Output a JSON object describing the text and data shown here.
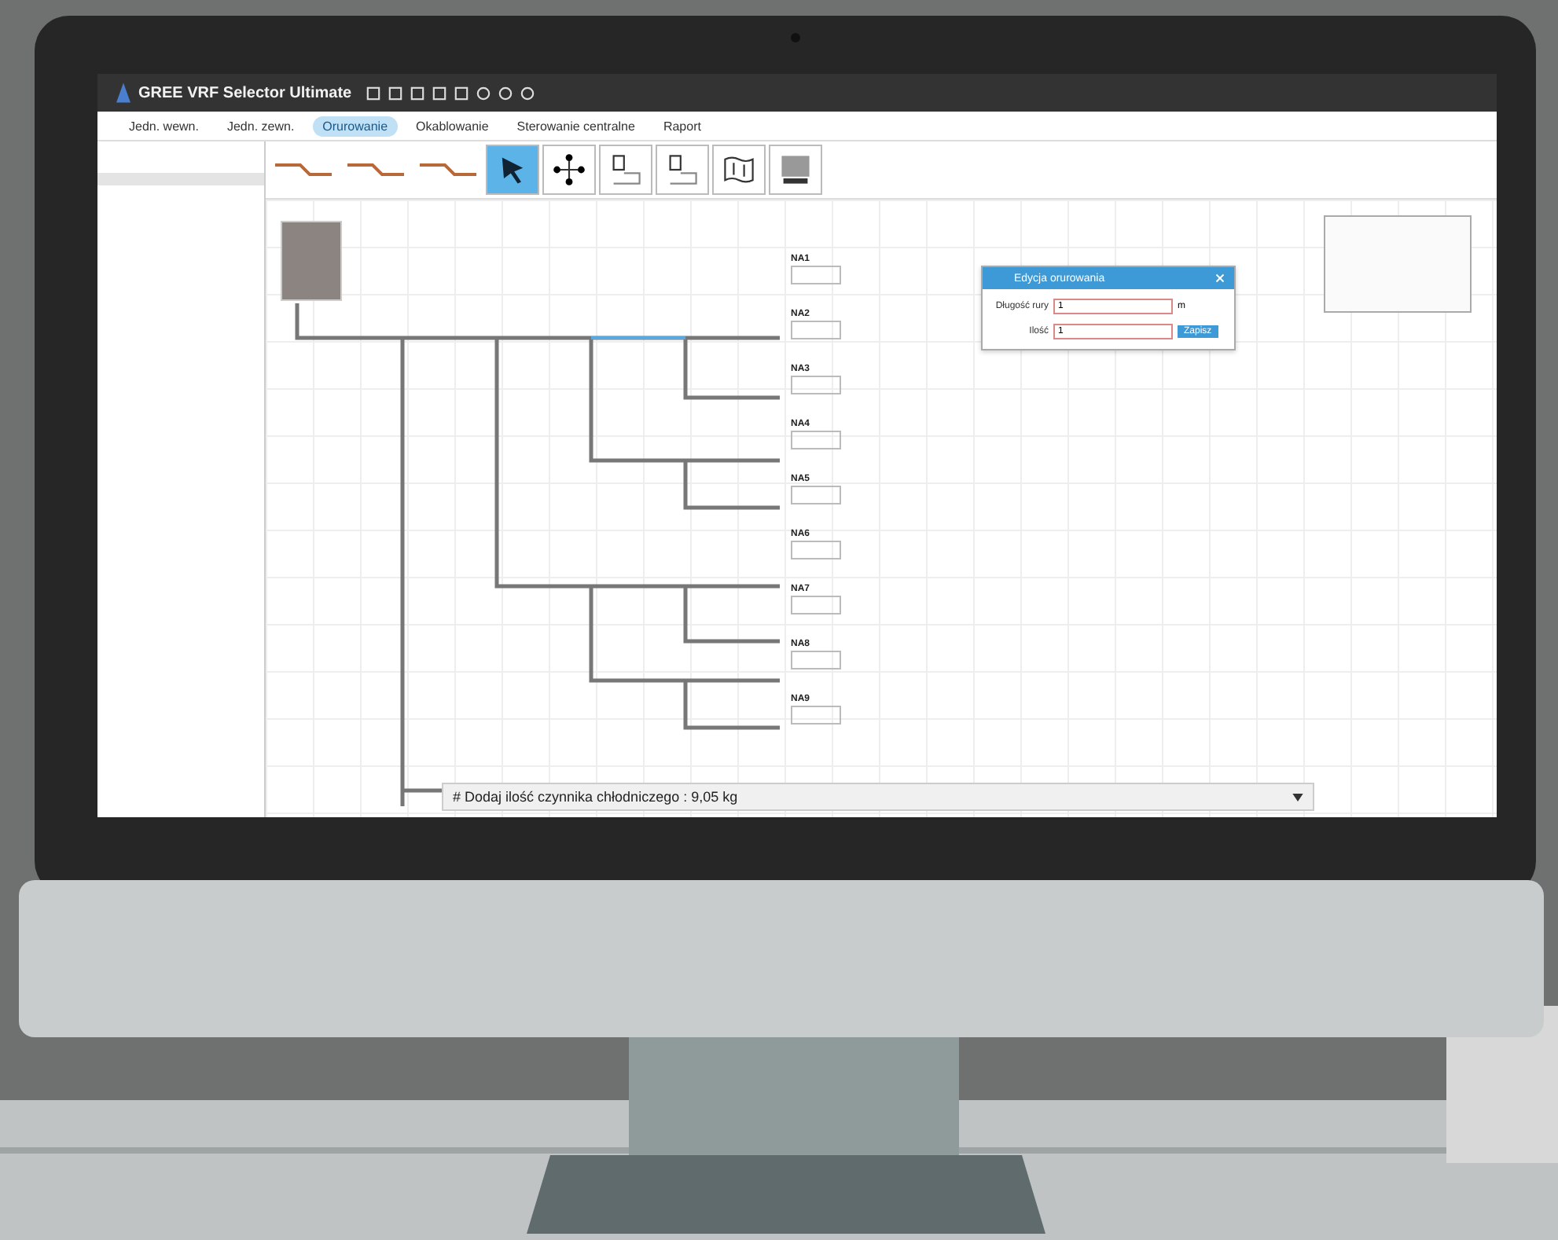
{
  "window": {
    "title": "GREE VRF Selector Ultimate"
  },
  "tabs": [
    {
      "label": "Jedn. wewn.",
      "selected": false
    },
    {
      "label": "Jedn. zewn.",
      "selected": false
    },
    {
      "label": "Orurowanie",
      "selected": true
    },
    {
      "label": "Okablowanie",
      "selected": false
    },
    {
      "label": "Sterowanie centralne",
      "selected": false
    },
    {
      "label": "Raport",
      "selected": false
    }
  ],
  "toolbar": [
    {
      "kind": "pipe",
      "selected": false
    },
    {
      "kind": "pipe",
      "selected": false
    },
    {
      "kind": "pipe",
      "selected": false
    },
    {
      "kind": "select",
      "selected": true
    },
    {
      "kind": "move",
      "selected": false
    },
    {
      "kind": "unit",
      "selected": false
    },
    {
      "kind": "unit",
      "selected": false
    },
    {
      "kind": "map",
      "selected": false
    },
    {
      "kind": "grid",
      "selected": false
    }
  ],
  "indoor_units": [
    {
      "label": "NA1"
    },
    {
      "label": "NA2"
    },
    {
      "label": "NA3"
    },
    {
      "label": "NA4"
    },
    {
      "label": "NA5"
    },
    {
      "label": "NA6"
    },
    {
      "label": "NA7"
    },
    {
      "label": "NA8"
    },
    {
      "label": "NA9"
    }
  ],
  "dialog": {
    "title": "Edycja orurowania",
    "length_label": "Długość rury",
    "length_value": "1",
    "unit": "m",
    "count_label": "Ilość",
    "count_value": "1",
    "button": "Zapisz"
  },
  "status_bar": {
    "text": "# Dodaj ilość czynnika chłodniczego : 9,05 kg"
  }
}
